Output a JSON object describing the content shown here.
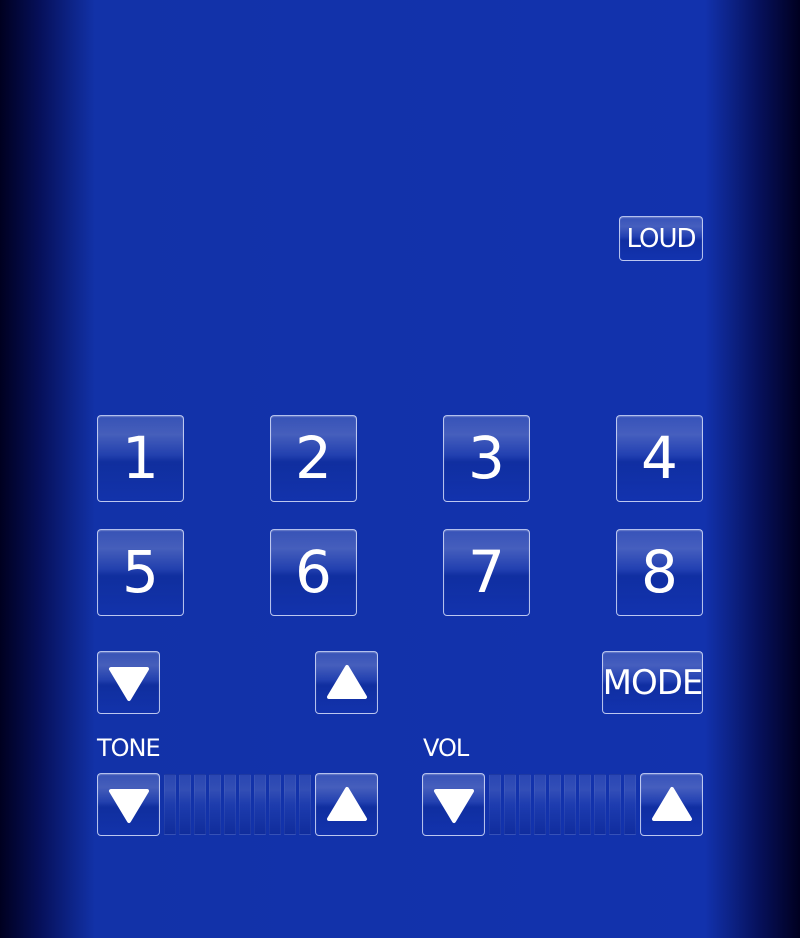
{
  "loud_button": {
    "label": "LOUD"
  },
  "number_buttons": [
    "1",
    "2",
    "3",
    "4",
    "5",
    "6",
    "7",
    "8"
  ],
  "mode_button": {
    "label": "MODE"
  },
  "tone": {
    "label": "TONE",
    "level_segments": 10,
    "level_active": 0
  },
  "vol": {
    "label": "VOL",
    "level_segments": 10,
    "level_active": 0
  },
  "icons": {
    "down": "triangle-down-icon",
    "up": "triangle-up-icon"
  },
  "colors": {
    "panel_blue": "#1232ad",
    "edge_dark": "#000020",
    "text": "#ffffff",
    "button_border": "#e1e8ff"
  }
}
